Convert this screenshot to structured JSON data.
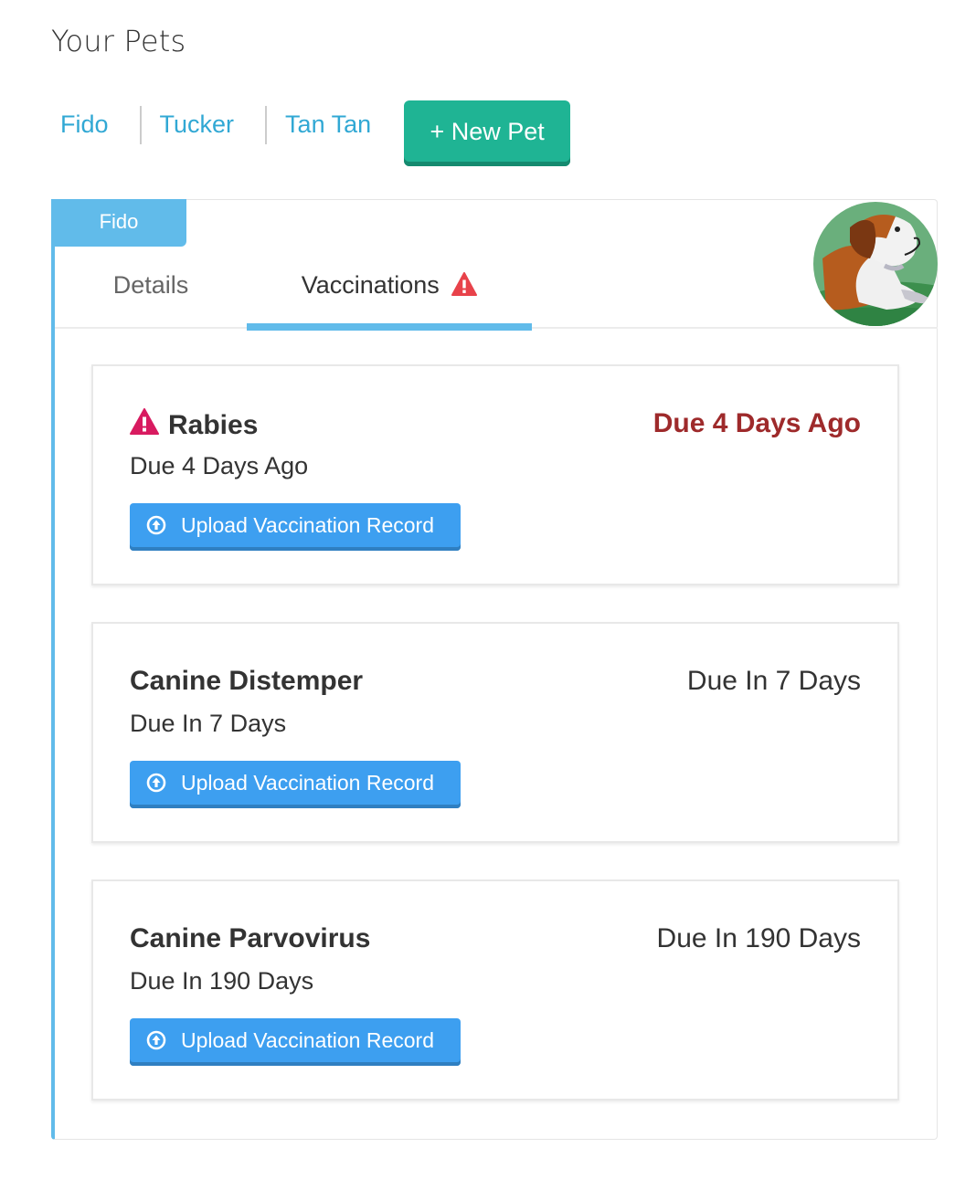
{
  "page": {
    "title": "Your Pets"
  },
  "pet_nav": {
    "pets": [
      "Fido",
      "Tucker",
      "Tan Tan"
    ],
    "new_pet_label": "+ New Pet"
  },
  "panel": {
    "pet_name": "Fido",
    "avatar_icon": "dog-avatar",
    "tabs": [
      {
        "label": "Details",
        "active": false
      },
      {
        "label": "Vaccinations",
        "active": true,
        "icon": "warning-icon"
      }
    ]
  },
  "vaccinations": [
    {
      "name": "Rabies",
      "status": "Due 4 Days Ago",
      "due": "Due 4 Days Ago",
      "overdue": true,
      "icon": "warning-icon",
      "upload_label": "Upload Vaccination Record"
    },
    {
      "name": "Canine Distemper",
      "status": "Due In 7 Days",
      "due": "Due In 7 Days",
      "overdue": false,
      "upload_label": "Upload Vaccination Record"
    },
    {
      "name": "Canine Parvovirus",
      "status": "Due In 190 Days",
      "due": "Due In 190 Days",
      "overdue": false,
      "upload_label": "Upload Vaccination Record"
    }
  ],
  "colors": {
    "accent_blue": "#61bbea",
    "link_blue": "#31a8d4",
    "new_pet_green": "#1fb494",
    "upload_blue": "#3d9ff0",
    "overdue_red": "#9e2a2b",
    "warning_red": "#e8424a",
    "warning_crimson": "#d81b60"
  }
}
